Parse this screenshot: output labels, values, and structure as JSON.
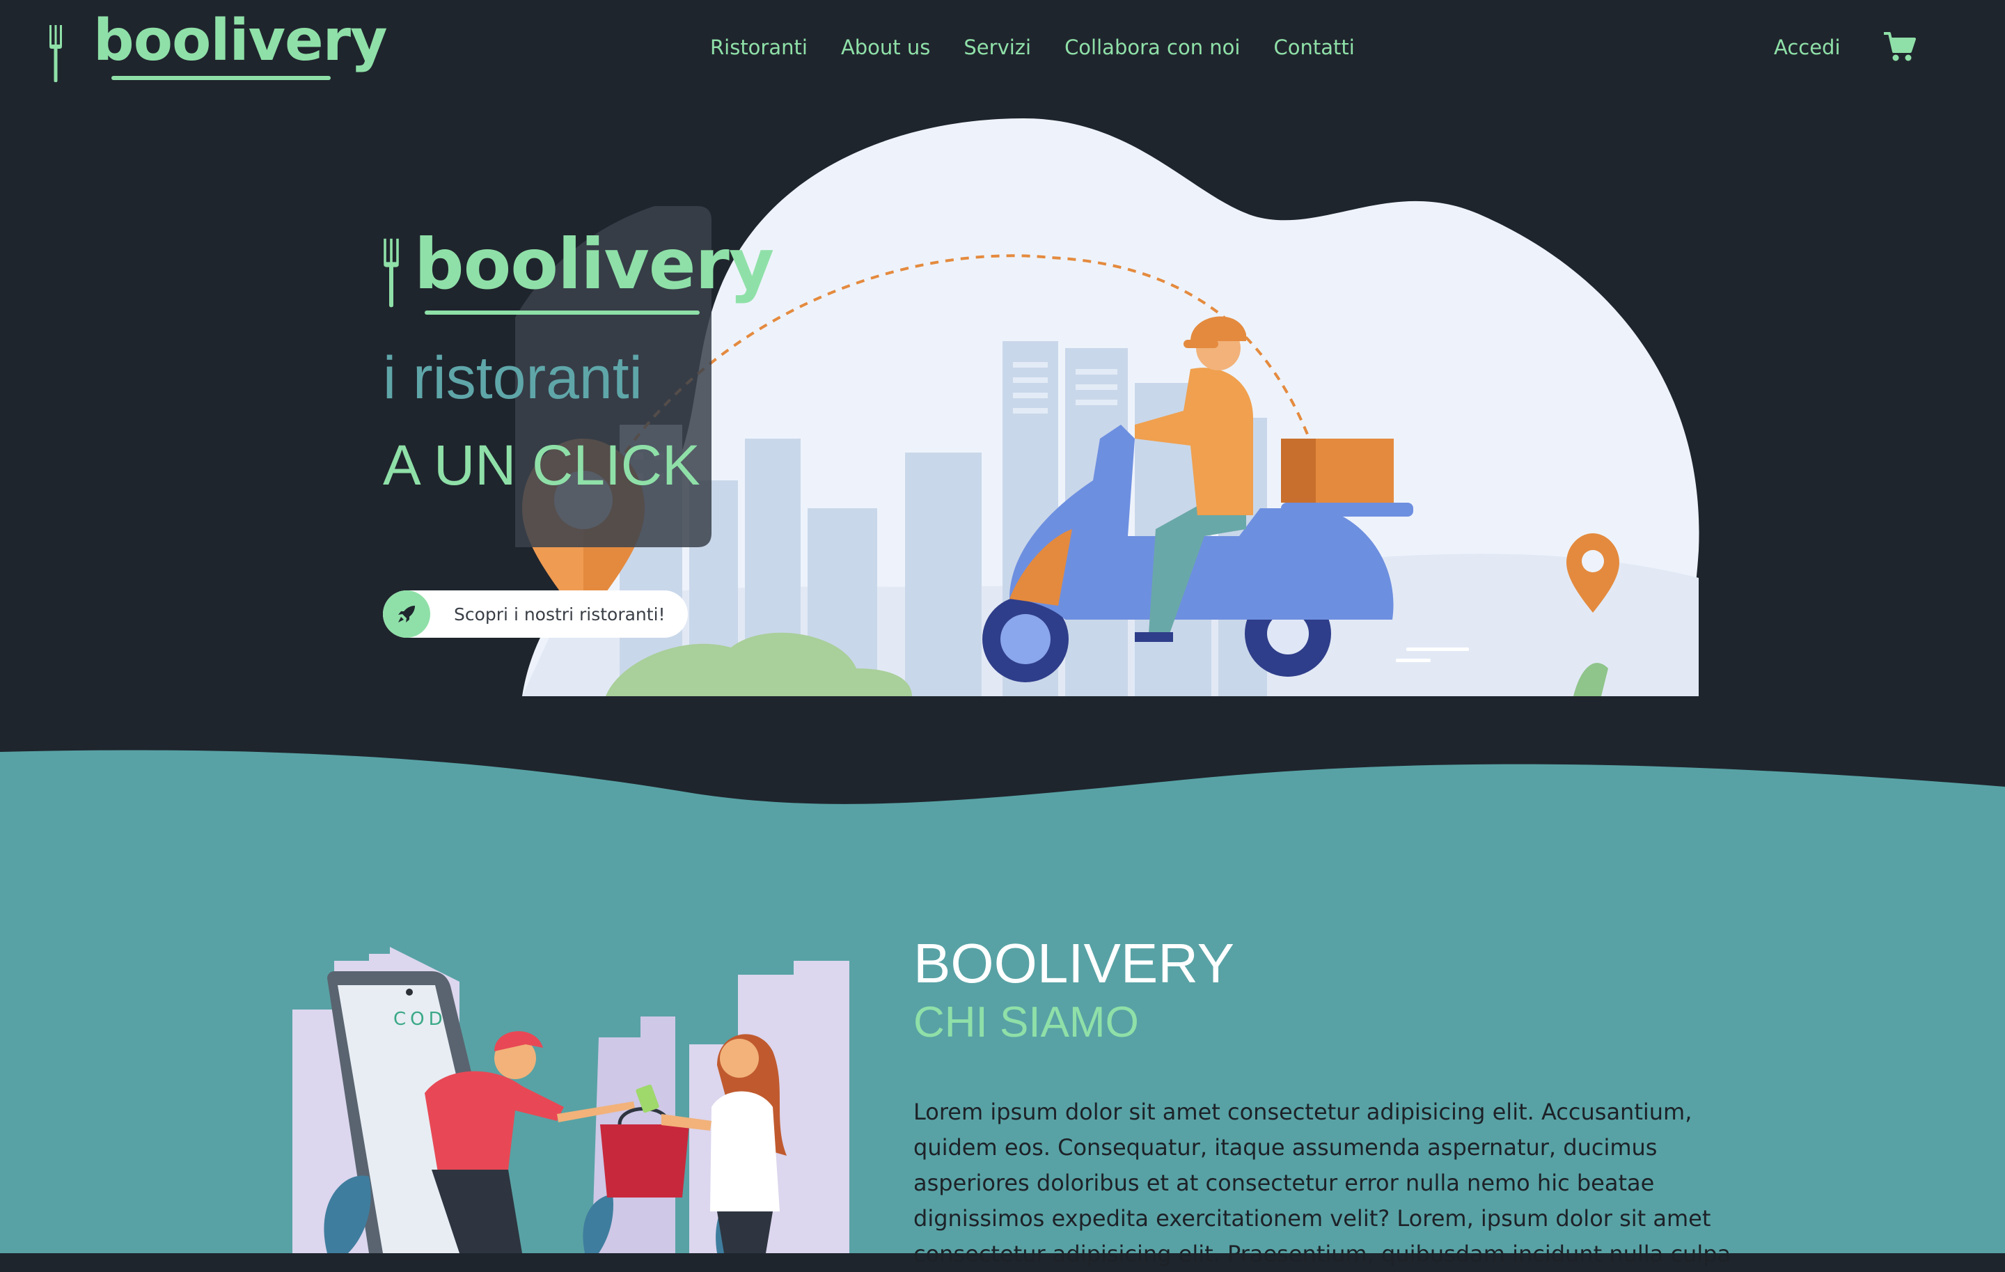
{
  "brand": {
    "name": "boolivery"
  },
  "nav": {
    "items": [
      "Ristoranti",
      "About us",
      "Servizi",
      "Collabora con noi",
      "Contatti"
    ],
    "login": "Accedi",
    "cart_icon": "cart-icon"
  },
  "hero": {
    "brand": "boolivery",
    "tagline_1": "i ristoranti",
    "tagline_2": "A UN CLICK",
    "cta_label": "Scopri i nostri ristoranti!",
    "cta_icon": "rocket-icon"
  },
  "about": {
    "title": "BOOLIVERY",
    "subtitle": "CHI SIAMO",
    "body": "Lorem ipsum dolor sit amet consectetur adipisicing elit. Accusantium, quidem eos. Consequatur, itaque assumenda aspernatur, ducimus asperiores doloribus et at consectetur error nulla nemo hic beatae dignissimos expedita exercitationem velit? Lorem, ipsum dolor sit amet consectetur adipisicing elit. Praesentium, quibusdam incidunt nulla culpa",
    "phone_label": "COD"
  },
  "colors": {
    "background": "#1f252d",
    "accent": "#8fe0a8",
    "teal": "#58a2a5",
    "orange": "#e48a3e",
    "scooter": "#6d8fe0"
  }
}
